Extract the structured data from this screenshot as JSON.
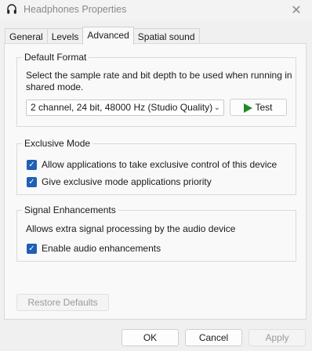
{
  "window": {
    "title": "Headphones Properties",
    "icon": "headphones-icon",
    "close_glyph": "✕"
  },
  "tabs": [
    {
      "label": "General",
      "active": false
    },
    {
      "label": "Levels",
      "active": false
    },
    {
      "label": "Advanced",
      "active": true
    },
    {
      "label": "Spatial sound",
      "active": false
    }
  ],
  "default_format": {
    "label": "Default Format",
    "description": "Select the sample rate and bit depth to be used when running in shared mode.",
    "selected_value": "2 channel, 24 bit, 48000 Hz (Studio Quality)",
    "test_label": "Test"
  },
  "exclusive_mode": {
    "label": "Exclusive Mode",
    "allow_label": "Allow applications to take exclusive control of this device",
    "allow_checked": true,
    "priority_label": "Give exclusive mode applications priority",
    "priority_checked": true
  },
  "signal_enhancements": {
    "label": "Signal Enhancements",
    "description": "Allows extra signal processing by the audio device",
    "enable_label": "Enable audio enhancements",
    "enable_checked": true
  },
  "restore_defaults_label": "Restore Defaults",
  "footer": {
    "ok_label": "OK",
    "cancel_label": "Cancel",
    "apply_label": "Apply"
  },
  "colors": {
    "checkbox": "#1f5fb4",
    "test_play": "#1e8a2a"
  }
}
